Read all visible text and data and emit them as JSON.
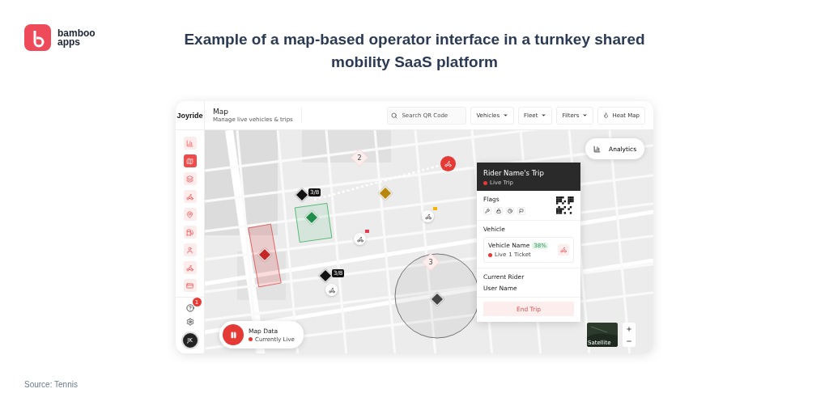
{
  "logo": {
    "line1": "bamboo",
    "line2": "apps"
  },
  "headline": "Example of a map-based operator interface in a turnkey shared mobility SaaS platform",
  "app": {
    "brand": "Joyride",
    "page_title": "Map",
    "page_subtitle": "Manage live vehicles & trips",
    "search": {
      "placeholder": "Search QR Code"
    },
    "dropdowns": [
      "Vehicles",
      "Fleet",
      "Filters"
    ],
    "heat_map": "Heat Map"
  },
  "sidebar": {
    "items": [
      {
        "kind": "chart",
        "selected": false
      },
      {
        "kind": "map",
        "selected": true
      },
      {
        "kind": "layers",
        "selected": false
      },
      {
        "kind": "scooter",
        "selected": false
      },
      {
        "kind": "pin",
        "selected": false
      },
      {
        "kind": "fuel",
        "selected": false
      },
      {
        "kind": "user",
        "selected": false
      },
      {
        "kind": "bike",
        "selected": false
      },
      {
        "kind": "card",
        "selected": false
      }
    ],
    "help_badge": "1",
    "avatar": "JK"
  },
  "map": {
    "clusters": [
      {
        "count": "2"
      },
      {
        "count": "3"
      }
    ],
    "vehicle_badges": [
      "3/8",
      "3/8"
    ],
    "analytics": "Analytics",
    "satellite": "Satellite",
    "map_data": {
      "title": "Map Data",
      "status": "Currently Live"
    }
  },
  "trip_panel": {
    "title": "Rider Name's Trip",
    "status": "Live Trip",
    "flags_label": "Flags",
    "vehicle_label": "Vehicle",
    "vehicle_name": "Vehicle Name",
    "battery": "38%",
    "vehicle_status": "Live",
    "tickets": "1 Ticket",
    "rider_label": "Current Rider",
    "rider_name": "User Name",
    "end_button": "End Trip"
  },
  "source": "Source: Tennis"
}
